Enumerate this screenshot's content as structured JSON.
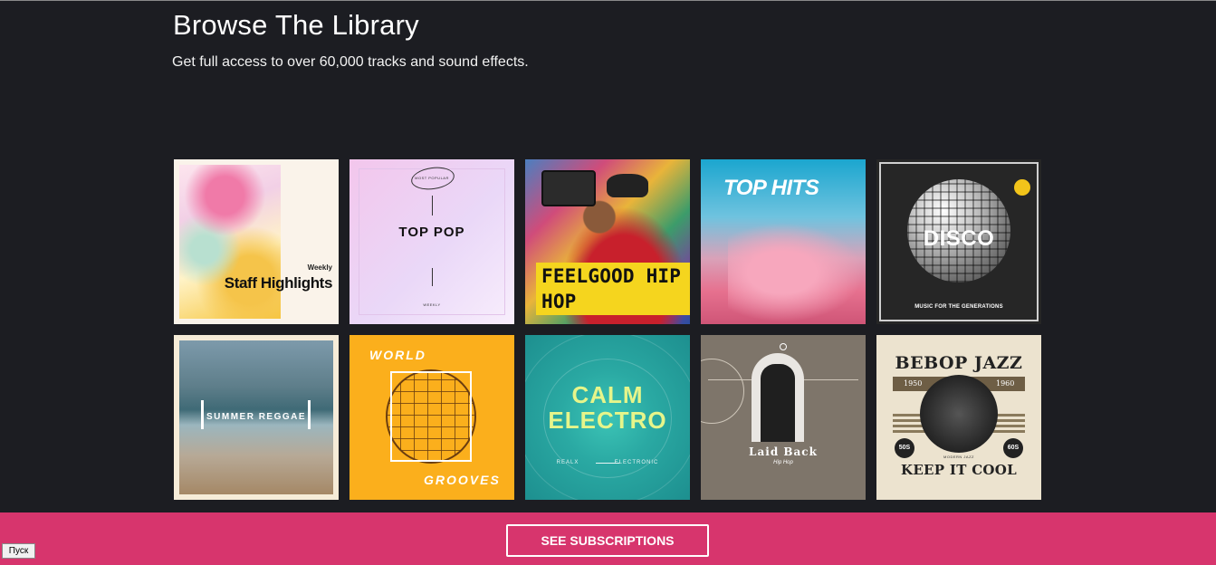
{
  "header": {
    "title": "Browse The Library",
    "subtitle": "Get full access to over 60,000 tracks and sound effects."
  },
  "tiles": [
    {
      "kind": "staff-highlights",
      "small": "Weekly",
      "big": "Staff Highlights"
    },
    {
      "kind": "top-pop",
      "badge": "MOST POPULAR",
      "big": "TOP POP",
      "footer": "WEEKLY"
    },
    {
      "kind": "feelgood-hiphop",
      "big": "FEELGOOD HIP HOP"
    },
    {
      "kind": "top-hits",
      "big": "TOP HITS"
    },
    {
      "kind": "disco",
      "big": "DISCO",
      "sub": "MUSIC FOR THE GENERATIONS"
    },
    {
      "kind": "summer-reggae",
      "big": "SUMMER REGGAE"
    },
    {
      "kind": "world-grooves",
      "top": "WORLD",
      "bottom": "GROOVES"
    },
    {
      "kind": "calm-electro",
      "big": "CALM ELECTRO",
      "tag1": "REALX",
      "tag2": "ELECTRONIC"
    },
    {
      "kind": "laid-back",
      "big": "Laid Back",
      "sub": "Hip Hop"
    },
    {
      "kind": "bebop-jazz",
      "big": "BEBOP JAZZ",
      "year1": "1950",
      "year2": "1960",
      "left_pill": "50S",
      "right_pill": "60S",
      "modern": "MODERN JAZZ",
      "bottom": "KEEP IT COOL"
    }
  ],
  "footer": {
    "cta_label": "SEE SUBSCRIPTIONS"
  },
  "taskbar": {
    "start_label": "Пуск"
  },
  "colors": {
    "page_bg": "#1c1d22",
    "footer_bg": "#d7356d",
    "text": "#ffffff"
  }
}
